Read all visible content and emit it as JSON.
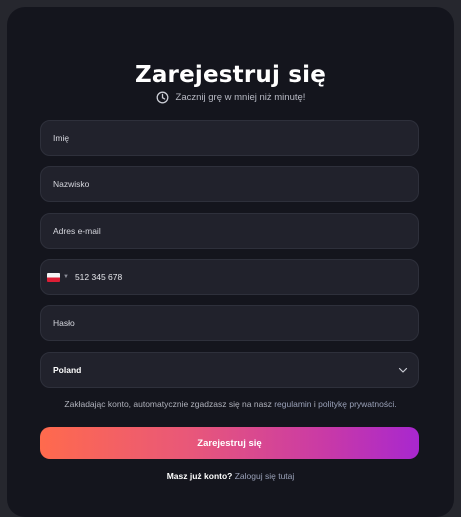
{
  "form": {
    "title": "Zarejestruj się",
    "subtitle": "Zacznij grę w mniej niż minutę!",
    "fields": {
      "first_name_placeholder": "Imię",
      "last_name_placeholder": "Nazwisko",
      "email_placeholder": "Adres e-mail",
      "phone_placeholder": "512 345 678",
      "password_placeholder": "Hasło",
      "country_value": "Poland"
    },
    "icons": {
      "subtitle": "clock-icon",
      "phone_country": "poland-flag-icon",
      "country_select": "chevron-down-icon"
    },
    "terms": {
      "prefix": "Zakładając konto, automatycznie zgadzasz się na nasz",
      "link1": "regulamin",
      "connector": "i",
      "link2": "politykę prywatności."
    },
    "submit_label": "Zarejestruj się",
    "login": {
      "question": "Masz już konto?",
      "link": "Zaloguj się tutaj"
    }
  },
  "colors": {
    "background": "#14151d",
    "field": "#21222c",
    "button_gradient_start": "#ff6a4d",
    "button_gradient_end": "#a827cf"
  }
}
